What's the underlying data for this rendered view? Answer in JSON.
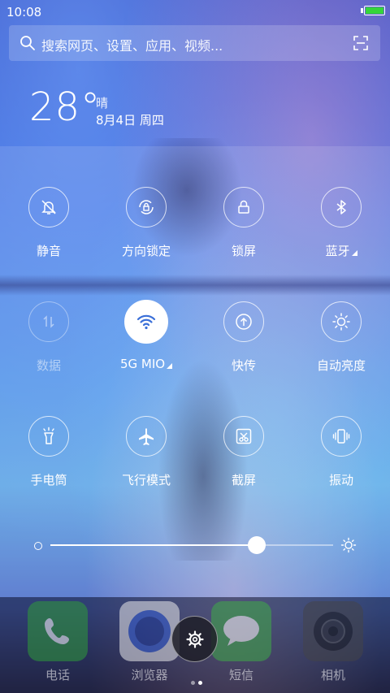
{
  "status_bar": {
    "time": "10:08",
    "battery_level": 1.0,
    "battery_color": "#35d53a"
  },
  "search": {
    "placeholder": "搜索网页、设置、应用、视频..."
  },
  "weather": {
    "temperature": "28°",
    "condition": "晴",
    "date": "8月4日 周四"
  },
  "toggles": [
    {
      "label": "静音",
      "icon": "silent-bell-icon",
      "state": "off"
    },
    {
      "label": "方向锁定",
      "icon": "rotation-lock-icon",
      "state": "off"
    },
    {
      "label": "锁屏",
      "icon": "lock-icon",
      "state": "off"
    },
    {
      "label": "蓝牙",
      "icon": "bluetooth-icon",
      "state": "off"
    },
    {
      "label": "数据",
      "icon": "mobile-data-icon",
      "state": "disabled"
    },
    {
      "label": "5G MIO",
      "icon": "wifi-icon",
      "state": "on"
    },
    {
      "label": "快传",
      "icon": "quick-transfer-icon",
      "state": "off"
    },
    {
      "label": "自动亮度",
      "icon": "auto-brightness-icon",
      "state": "off"
    },
    {
      "label": "手电筒",
      "icon": "flashlight-icon",
      "state": "off"
    },
    {
      "label": "飞行模式",
      "icon": "airplane-icon",
      "state": "off"
    },
    {
      "label": "截屏",
      "icon": "screenshot-icon",
      "state": "off"
    },
    {
      "label": "振动",
      "icon": "vibrate-icon",
      "state": "off"
    }
  ],
  "brightness": {
    "level": 0.73
  },
  "dock": {
    "apps": [
      {
        "label": "电话",
        "icon": "phone-icon",
        "color": "#2f9b3a"
      },
      {
        "label": "浏览器",
        "icon": "browser-icon",
        "color": "#e8e8ea"
      },
      {
        "label": "短信",
        "icon": "sms-icon",
        "color": "#3faa48"
      },
      {
        "label": "相机",
        "icon": "camera-icon",
        "color": "#444448"
      }
    ]
  },
  "page_indicator": {
    "count": 2,
    "current": 1
  }
}
